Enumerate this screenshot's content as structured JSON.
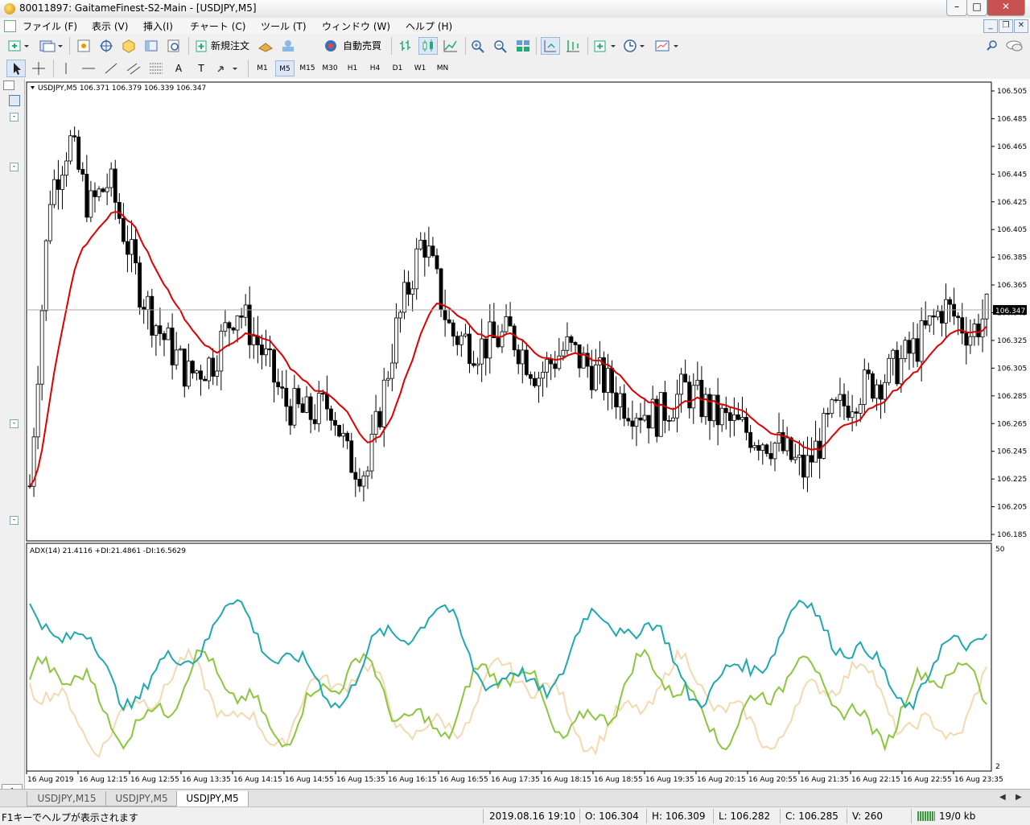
{
  "window": {
    "title": "80011897: GaitameFinest-S2-Main - [USDJPY,M5]",
    "minimize": "–",
    "maximize": "□",
    "close": "✕"
  },
  "menu": {
    "items": [
      "ファイル (F)",
      "表示 (V)",
      "挿入(I)",
      "チャート (C)",
      "ツール (T)",
      "ウィンドウ (W)",
      "ヘルプ (H)"
    ]
  },
  "toolbar": {
    "new_order": "新規注文",
    "auto_trade": "自動売買"
  },
  "timeframes": [
    "M1",
    "M5",
    "M15",
    "M30",
    "H1",
    "H4",
    "D1",
    "W1",
    "MN"
  ],
  "active_timeframe": "M5",
  "drawing_tools": {
    "text_tool": "A",
    "label_tool": "T"
  },
  "chart": {
    "symbol_header": "USDJPY,M5  106.371 106.379 106.339 106.347",
    "current_price": "106.347",
    "price_labels": [
      "106.505",
      "106.485",
      "106.465",
      "106.445",
      "106.425",
      "106.405",
      "106.385",
      "106.365",
      "106.345",
      "106.325",
      "106.305",
      "106.285",
      "106.265",
      "106.245",
      "106.225",
      "106.205",
      "106.185"
    ],
    "indicator_header": "ADX(14) 21.4116 +DI:21.4861 -DI:16.5629",
    "indicator_scale": [
      "50",
      "2"
    ],
    "time_labels": [
      "16 Aug 2019",
      "16 Aug 12:15",
      "16 Aug 12:55",
      "16 Aug 13:35",
      "16 Aug 14:15",
      "16 Aug 14:55",
      "16 Aug 15:35",
      "16 Aug 16:15",
      "16 Aug 16:55",
      "16 Aug 17:35",
      "16 Aug 18:15",
      "16 Aug 18:55",
      "16 Aug 19:35",
      "16 Aug 20:15",
      "16 Aug 20:55",
      "16 Aug 21:35",
      "16 Aug 22:15",
      "16 Aug 22:55",
      "16 Aug 23:35"
    ],
    "colors": {
      "ma": "#dd0000",
      "adx": "#20a8b0",
      "plus_di": "#8cc63e",
      "minus_di": "#f4d9b0",
      "candle": "#000000"
    }
  },
  "tabs": [
    "USDJPY,M15",
    "USDJPY,M5",
    "USDJPY,M5"
  ],
  "active_tab": 2,
  "status": {
    "help": "F1キーでヘルプが表示されます",
    "datetime": "2019.08.16 19:10",
    "open": "O: 106.304",
    "high": "H: 106.309",
    "low": "L: 106.282",
    "close": "C: 106.285",
    "volume": "V: 260",
    "traffic": "19/0 kb"
  }
}
